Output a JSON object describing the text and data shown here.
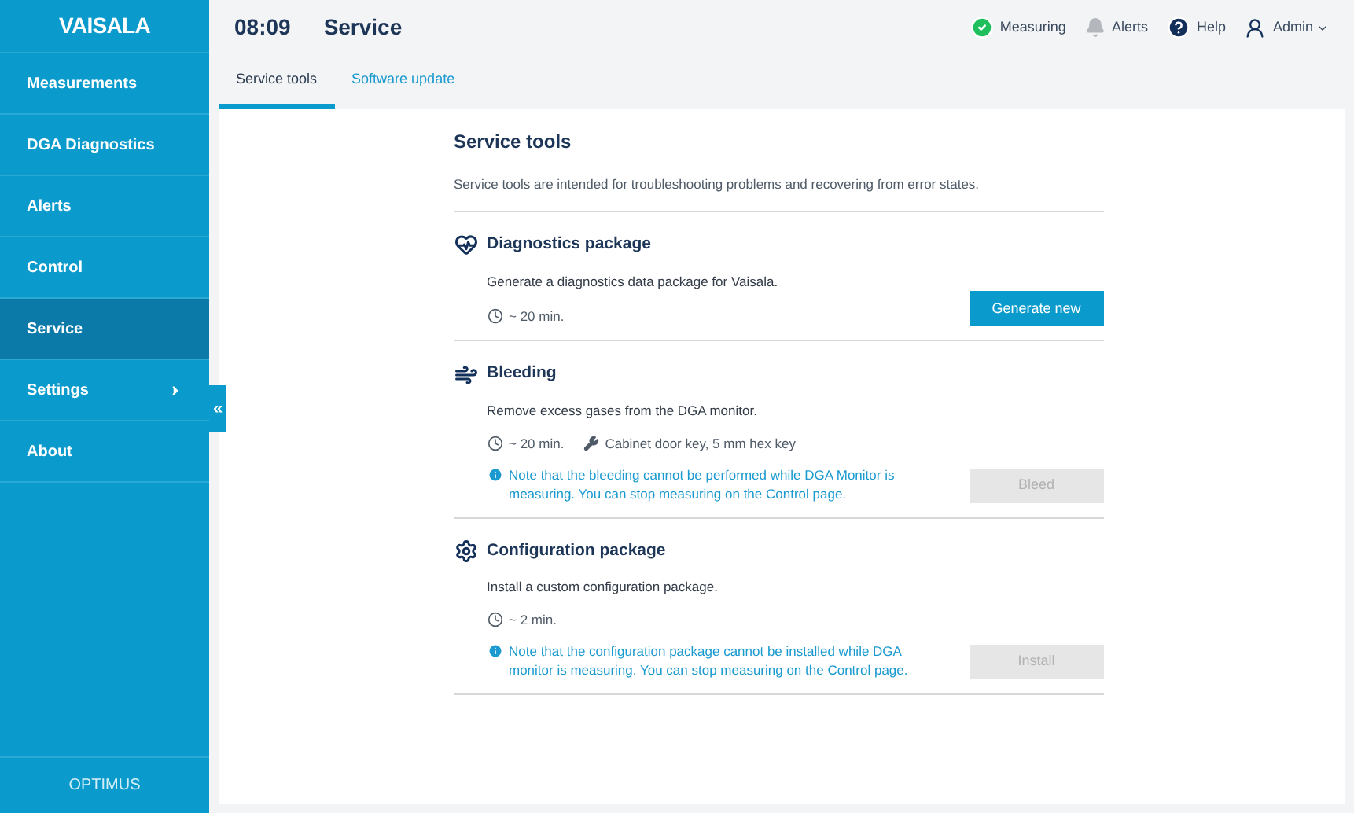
{
  "brand": "VAISALA",
  "sidebar": {
    "items": [
      {
        "label": "Measurements",
        "selected": false,
        "has_submenu": false
      },
      {
        "label": "DGA Diagnostics",
        "selected": false,
        "has_submenu": false
      },
      {
        "label": "Alerts",
        "selected": false,
        "has_submenu": false
      },
      {
        "label": "Control",
        "selected": false,
        "has_submenu": false
      },
      {
        "label": "Service",
        "selected": true,
        "has_submenu": false
      },
      {
        "label": "Settings",
        "selected": false,
        "has_submenu": true
      },
      {
        "label": "About",
        "selected": false,
        "has_submenu": false
      }
    ],
    "collapse": "«",
    "footer": "OPTIMUS"
  },
  "header": {
    "time": "08:09",
    "title": "Service",
    "status": "Measuring",
    "alerts": "Alerts",
    "help": "Help",
    "user": "Admin"
  },
  "tabs": [
    {
      "label": "Service tools",
      "selected": true
    },
    {
      "label": "Software update",
      "selected": false
    }
  ],
  "page": {
    "title": "Service tools",
    "intro": "Service tools are intended for troubleshooting problems and recovering from error states.",
    "sections": [
      {
        "kind": "diagnostics",
        "title": "Diagnostics package",
        "description": "Generate a diagnostics data package for Vaisala.",
        "duration": "~ 20 min.",
        "button": "Generate new",
        "disabled": false
      },
      {
        "kind": "bleeding",
        "title": "Bleeding",
        "description": "Remove excess gases from the DGA monitor.",
        "duration": "~ 20 min.",
        "tools": "Cabinet door key, 5 mm hex key",
        "note": "Note that the bleeding cannot be performed while DGA Monitor is measuring. You can stop measuring on the Control page.",
        "button": "Bleed",
        "disabled": true
      },
      {
        "kind": "configuration",
        "title": "Configuration package",
        "description": "Install a custom configuration package.",
        "duration": "~ 2 min.",
        "note": "Note that the configuration package cannot be installed while DGA monitor is measuring. You can stop measuring on the Control page.",
        "button": "Install",
        "disabled": true
      }
    ]
  }
}
